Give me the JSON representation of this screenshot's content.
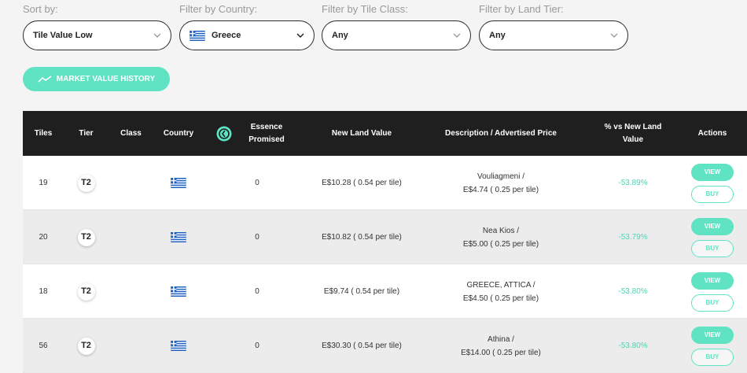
{
  "filters": {
    "sort": {
      "label": "Sort by:",
      "value": "Tile Value Low"
    },
    "country": {
      "label": "Filter by Country:",
      "value": "Greece"
    },
    "tile_class": {
      "label": "Filter by Tile Class:",
      "value": "Any"
    },
    "land_tier": {
      "label": "Filter by Land Tier:",
      "value": "Any"
    }
  },
  "history_button": {
    "label": "MARKET VALUE HISTORY"
  },
  "table": {
    "headers": {
      "tiles": "Tiles",
      "tier": "Tier",
      "class": "Class",
      "country": "Country",
      "essence_promised": "Essence Promised",
      "new_land_value": "New Land Value",
      "description": "Description / Advertised Price",
      "pct_vs_new": "% vs New Land Value",
      "actions": "Actions"
    },
    "rows": [
      {
        "tiles": "19",
        "tier": "T2",
        "essence": "0",
        "new_land_value": "E$10.28 ( 0.54 per tile)",
        "desc_name": "Vouliagmeni /",
        "desc_price": "E$4.74 ( 0.25 per tile)",
        "pct": "-53.89%"
      },
      {
        "tiles": "20",
        "tier": "T2",
        "essence": "0",
        "new_land_value": "E$10.82 ( 0.54 per tile)",
        "desc_name": "Nea Kios /",
        "desc_price": "E$5.00 ( 0.25 per tile)",
        "pct": "-53.79%"
      },
      {
        "tiles": "18",
        "tier": "T2",
        "essence": "0",
        "new_land_value": "E$9.74 ( 0.54 per tile)",
        "desc_name": "GREECE, ATTICA /",
        "desc_price": "E$4.50 ( 0.25 per tile)",
        "pct": "-53.80%"
      },
      {
        "tiles": "56",
        "tier": "T2",
        "essence": "0",
        "new_land_value": "E$30.30 ( 0.54 per tile)",
        "desc_name": "Athina /",
        "desc_price": "E$14.00 ( 0.25 per tile)",
        "pct": "-53.80%"
      }
    ],
    "view_label": "VIEW",
    "buy_label": "BUY"
  },
  "colors": {
    "accent": "#5fe3c3",
    "header_bg": "#1f1f1f",
    "percent_text": "#4ad6b3"
  },
  "icons": {
    "chevron": "chevron-down-icon",
    "flag": "greece-flag-icon",
    "essence": "essence-icon",
    "trend": "trend-line-icon"
  }
}
